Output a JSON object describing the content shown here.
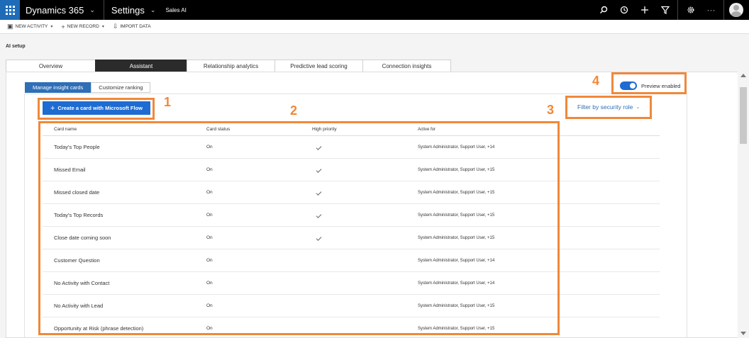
{
  "topbar": {
    "app_name": "Dynamics 365",
    "area_name": "Settings",
    "entity_name": "Sales AI",
    "icons": [
      "search-icon",
      "recent-icon",
      "add-icon",
      "filter-icon",
      "settings-icon",
      "more-icon",
      "user-avatar"
    ]
  },
  "commands": [
    {
      "icon": "new-activity-icon",
      "label": "NEW ACTIVITY"
    },
    {
      "icon": "add-icon",
      "label": "NEW RECORD"
    },
    {
      "icon": "import-icon",
      "label": "IMPORT DATA"
    }
  ],
  "page_title": "AI setup",
  "main_tabs": [
    {
      "label": "Overview",
      "active": false
    },
    {
      "label": "Assistant",
      "active": true
    },
    {
      "label": "Relationship analytics",
      "active": false
    },
    {
      "label": "Predictive lead scoring",
      "active": false
    },
    {
      "label": "Connection insights",
      "active": false
    }
  ],
  "sub_tabs": [
    {
      "label": "Manage insight cards",
      "active": true
    },
    {
      "label": "Customize ranking",
      "active": false
    }
  ],
  "flow_button": {
    "label": "Create a card with Microsoft Flow"
  },
  "preview_toggle": {
    "label": "Preview enabled",
    "enabled": true
  },
  "filter": {
    "label": "Filter by security role"
  },
  "table": {
    "headers": [
      "Card name",
      "Card status",
      "High priority",
      "Active for"
    ],
    "rows": [
      {
        "name": "Today's Top People",
        "status": "On",
        "high_priority": true,
        "active_for": "System Administrator, Support User, +14"
      },
      {
        "name": "Missed Email",
        "status": "On",
        "high_priority": true,
        "active_for": "System Administrator, Support User, +15"
      },
      {
        "name": "Missed closed date",
        "status": "On",
        "high_priority": true,
        "active_for": "System Administrator, Support User, +15"
      },
      {
        "name": "Today's Top Records",
        "status": "On",
        "high_priority": true,
        "active_for": "System Administrator, Support User, +15"
      },
      {
        "name": "Close date coming soon",
        "status": "On",
        "high_priority": true,
        "active_for": "System Administrator, Support User, +15"
      },
      {
        "name": "Customer Question",
        "status": "On",
        "high_priority": false,
        "active_for": "System Administrator, Support User, +14"
      },
      {
        "name": "No Activity with Contact",
        "status": "On",
        "high_priority": false,
        "active_for": "System Administrator, Support User, +14"
      },
      {
        "name": "No Activity with Lead",
        "status": "On",
        "high_priority": false,
        "active_for": "System Administrator, Support User, +15"
      },
      {
        "name": "Opportunity at Risk (phrase detection)",
        "status": "On",
        "high_priority": false,
        "active_for": "System Administrator, Support User, +15"
      }
    ]
  },
  "annotations": [
    {
      "number": "1"
    },
    {
      "number": "2"
    },
    {
      "number": "3"
    },
    {
      "number": "4"
    }
  ],
  "colors": {
    "accent": "#1e6bd2",
    "highlight": "#f0883a",
    "topbar": "#000000"
  }
}
